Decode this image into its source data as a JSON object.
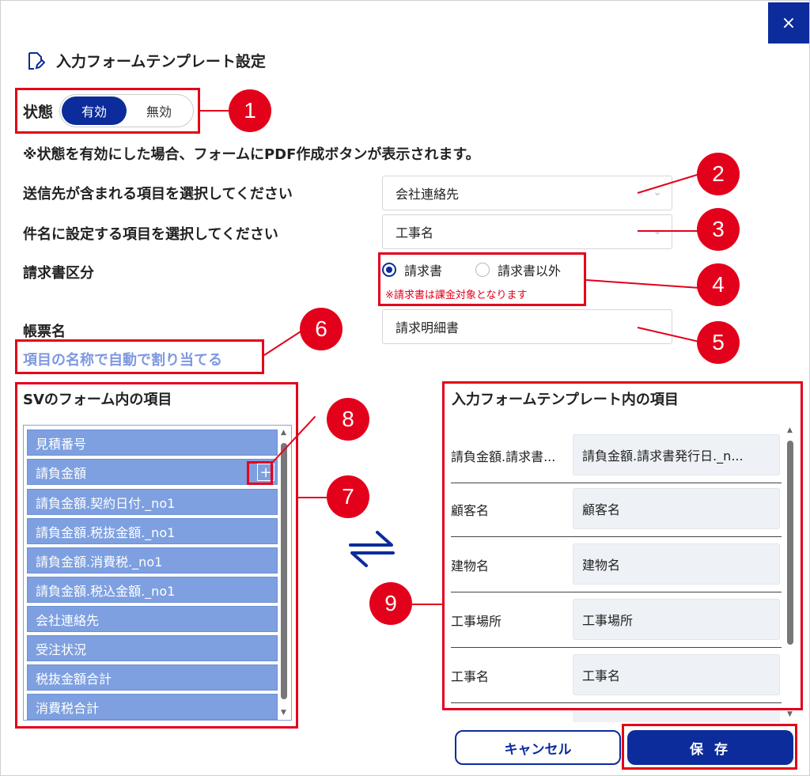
{
  "dialog": {
    "title": "入力フォームテンプレート設定",
    "close_label": "×"
  },
  "status": {
    "label": "状態",
    "on_label": "有効",
    "off_label": "無効",
    "selected": "有効",
    "note": "※状態を有効にした場合、フォームにPDF作成ボタンが表示されます。"
  },
  "recipient": {
    "label": "送信先が含まれる項目を選択してください",
    "value": "会社連絡先"
  },
  "subject": {
    "label": "件名に設定する項目を選択してください",
    "value": "工事名"
  },
  "invoice_type": {
    "label": "請求書区分",
    "options": [
      "請求書",
      "請求書以外"
    ],
    "selected": "請求書",
    "note": "※請求書は課金対象となります"
  },
  "form_name": {
    "label": "帳票名",
    "value": "請求明細書",
    "auto_assign_link": "項目の名称で自動で割り当てる"
  },
  "left_panel": {
    "title": "SVのフォーム内の項目",
    "items": [
      "見積番号",
      "請負金額",
      "請負金額.契約日付._no1",
      "請負金額.税抜金額._no1",
      "請負金額.消費税._no1",
      "請負金額.税込金額._no1",
      "会社連絡先",
      "受注状況",
      "税抜金額合計",
      "消費税合計"
    ],
    "plus_label": "+"
  },
  "right_panel": {
    "title": "入力フォームテンプレート内の項目",
    "rows": [
      {
        "label": "請負金額.請求書...",
        "value": "請負金額.請求書発行日._n..."
      },
      {
        "label": "顧客名",
        "value": "顧客名"
      },
      {
        "label": "建物名",
        "value": "建物名"
      },
      {
        "label": "工事場所",
        "value": "工事場所"
      },
      {
        "label": "工事名",
        "value": "工事名"
      }
    ]
  },
  "footer": {
    "cancel_label": "キャンセル",
    "save_label": "保 存"
  },
  "annotations": [
    "1",
    "2",
    "3",
    "4",
    "5",
    "6",
    "7",
    "8",
    "9"
  ],
  "colors": {
    "primary": "#0c2c9b",
    "item_bg": "#7ea0e0",
    "annotation_red": "#e3001b",
    "link": "#7e99e0"
  }
}
